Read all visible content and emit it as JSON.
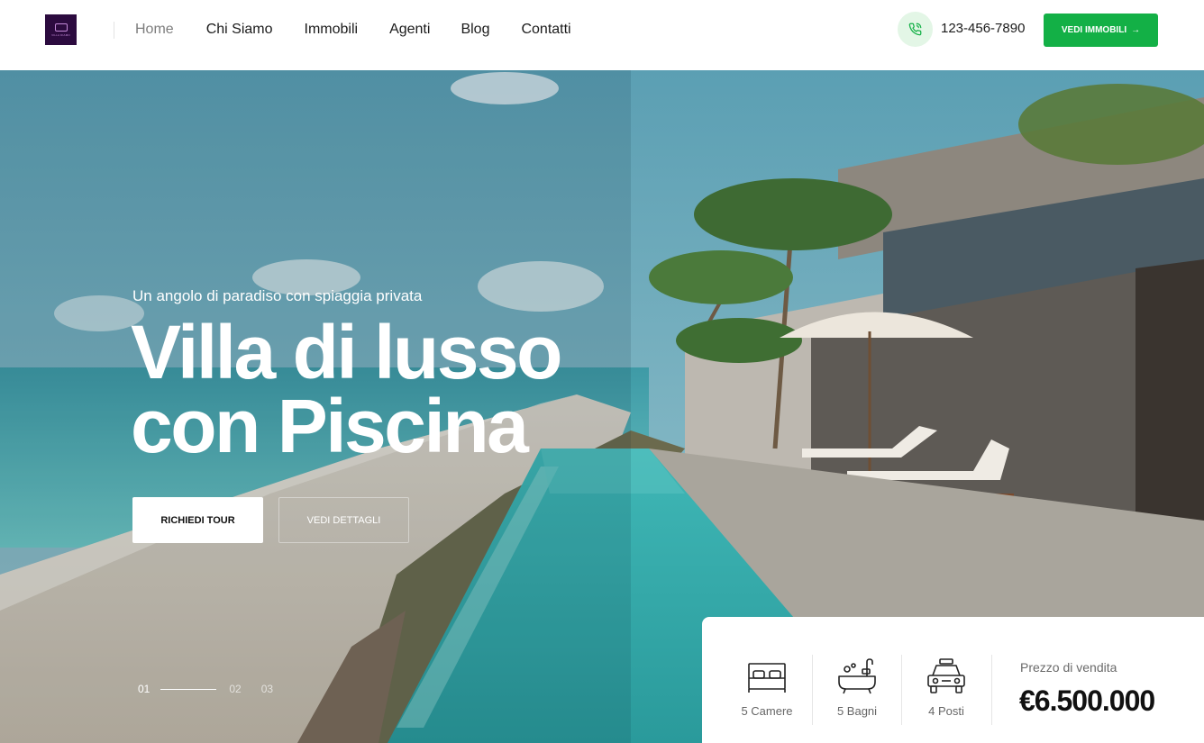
{
  "logo": {
    "name": "logo",
    "text": "VILLA DIAMO"
  },
  "nav": {
    "items": [
      {
        "label": "Home",
        "active": true
      },
      {
        "label": "Chi Siamo"
      },
      {
        "label": "Immobili"
      },
      {
        "label": "Agenti"
      },
      {
        "label": "Blog"
      },
      {
        "label": "Contatti"
      }
    ]
  },
  "header": {
    "phone": "123-456-7890",
    "phone_icon": "phone-icon",
    "cta_label": "VEDI IMMOBILI",
    "cta_icon": "arrow-right-icon"
  },
  "hero": {
    "eyebrow": "Un angolo di paradiso con spiaggia privata",
    "title_line1": "Villa di lusso",
    "title_line2_regular": "con",
    "title_line2_bold": "Piscina",
    "primary_button": "RICHIEDI TOUR",
    "secondary_button": "VEDI DETTAGLI",
    "slides": [
      "01",
      "02",
      "03"
    ],
    "current_slide": 1
  },
  "property": {
    "features": [
      {
        "icon": "bed-icon",
        "label": "5 Camere"
      },
      {
        "icon": "bathtub-icon",
        "label": "5 Bagni"
      },
      {
        "icon": "car-icon",
        "label": "4 Posti"
      }
    ],
    "price_label": "Prezzo di vendita",
    "price": "€6.500.000"
  },
  "colors": {
    "brand_green": "#13b046",
    "logo_bg": "#2c0b3f",
    "phone_circle_bg": "#e3f6e6",
    "nav_active": "#7d7d7d"
  }
}
